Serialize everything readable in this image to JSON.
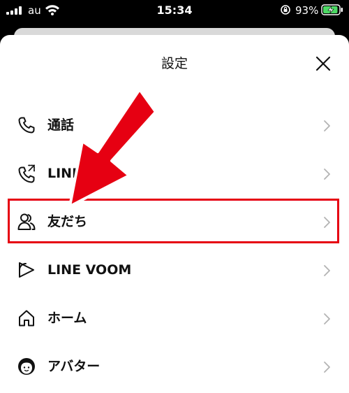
{
  "status_bar": {
    "carrier": "au",
    "time": "15:34",
    "battery_percent": "93%",
    "battery_level": 0.93,
    "charging": true,
    "signal_icon": "signal-bars-icon",
    "wifi_icon": "wifi-icon",
    "orientation_lock_icon": "orientation-lock-icon"
  },
  "sheet": {
    "title": "設定",
    "close_icon": "close-icon"
  },
  "menu": {
    "items": [
      {
        "label": "通話",
        "icon": "phone-icon"
      },
      {
        "label": "LINE",
        "icon": "phone-out-icon"
      },
      {
        "label": "友だち",
        "icon": "friends-icon",
        "highlighted": true
      },
      {
        "label": "LINE VOOM",
        "icon": "voom-icon"
      },
      {
        "label": "ホーム",
        "icon": "home-icon"
      },
      {
        "label": "アバター",
        "icon": "avatar-icon"
      }
    ]
  },
  "annotation": {
    "highlight_color": "#e60012",
    "arrow_color": "#e60012",
    "arrow_icon": "red-arrow-icon"
  }
}
